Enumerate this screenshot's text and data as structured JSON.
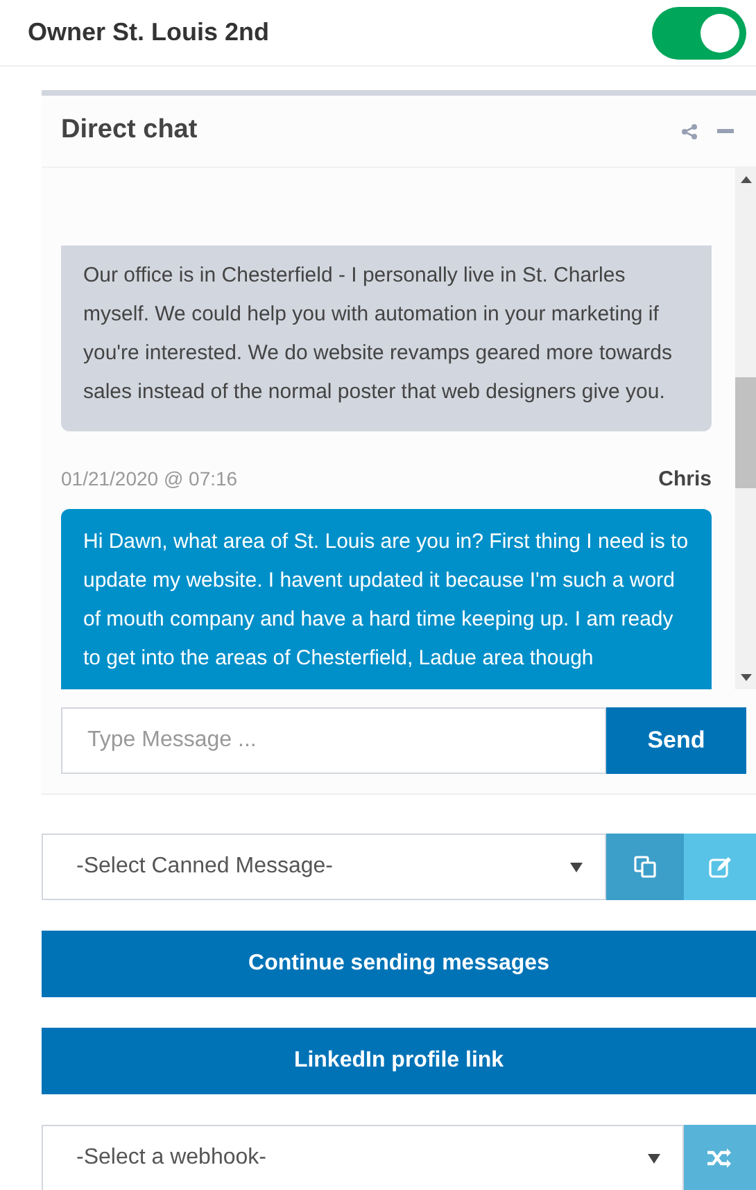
{
  "header": {
    "title": "Owner St. Louis 2nd",
    "toggle_on": true
  },
  "chat": {
    "title": "Direct chat",
    "messages": [
      {
        "kind": "received",
        "text": "Our office is in Chesterfield - I personally live in St. Charles myself. We could help you with automation in your marketing if you're interested. We do website revamps geared more towards sales instead of the normal poster that web designers give you."
      },
      {
        "kind": "sent",
        "time": "01/21/2020 @ 07:16",
        "author": "Chris",
        "text": "Hi Dawn, what area of St. Louis are you in? First thing I need is to update my website. I havent updated it because I'm such a word of mouth company and have a hard time keeping up. I am ready to get into the areas of Chesterfield, Ladue area though"
      }
    ],
    "input": {
      "placeholder": "Type Message ..."
    },
    "send_label": "Send"
  },
  "canned_select": {
    "value": "-Select Canned Message-"
  },
  "buttons": [
    "Continue sending messages",
    "LinkedIn profile link"
  ],
  "webhook_select": {
    "value": "-Select a webhook-"
  }
}
